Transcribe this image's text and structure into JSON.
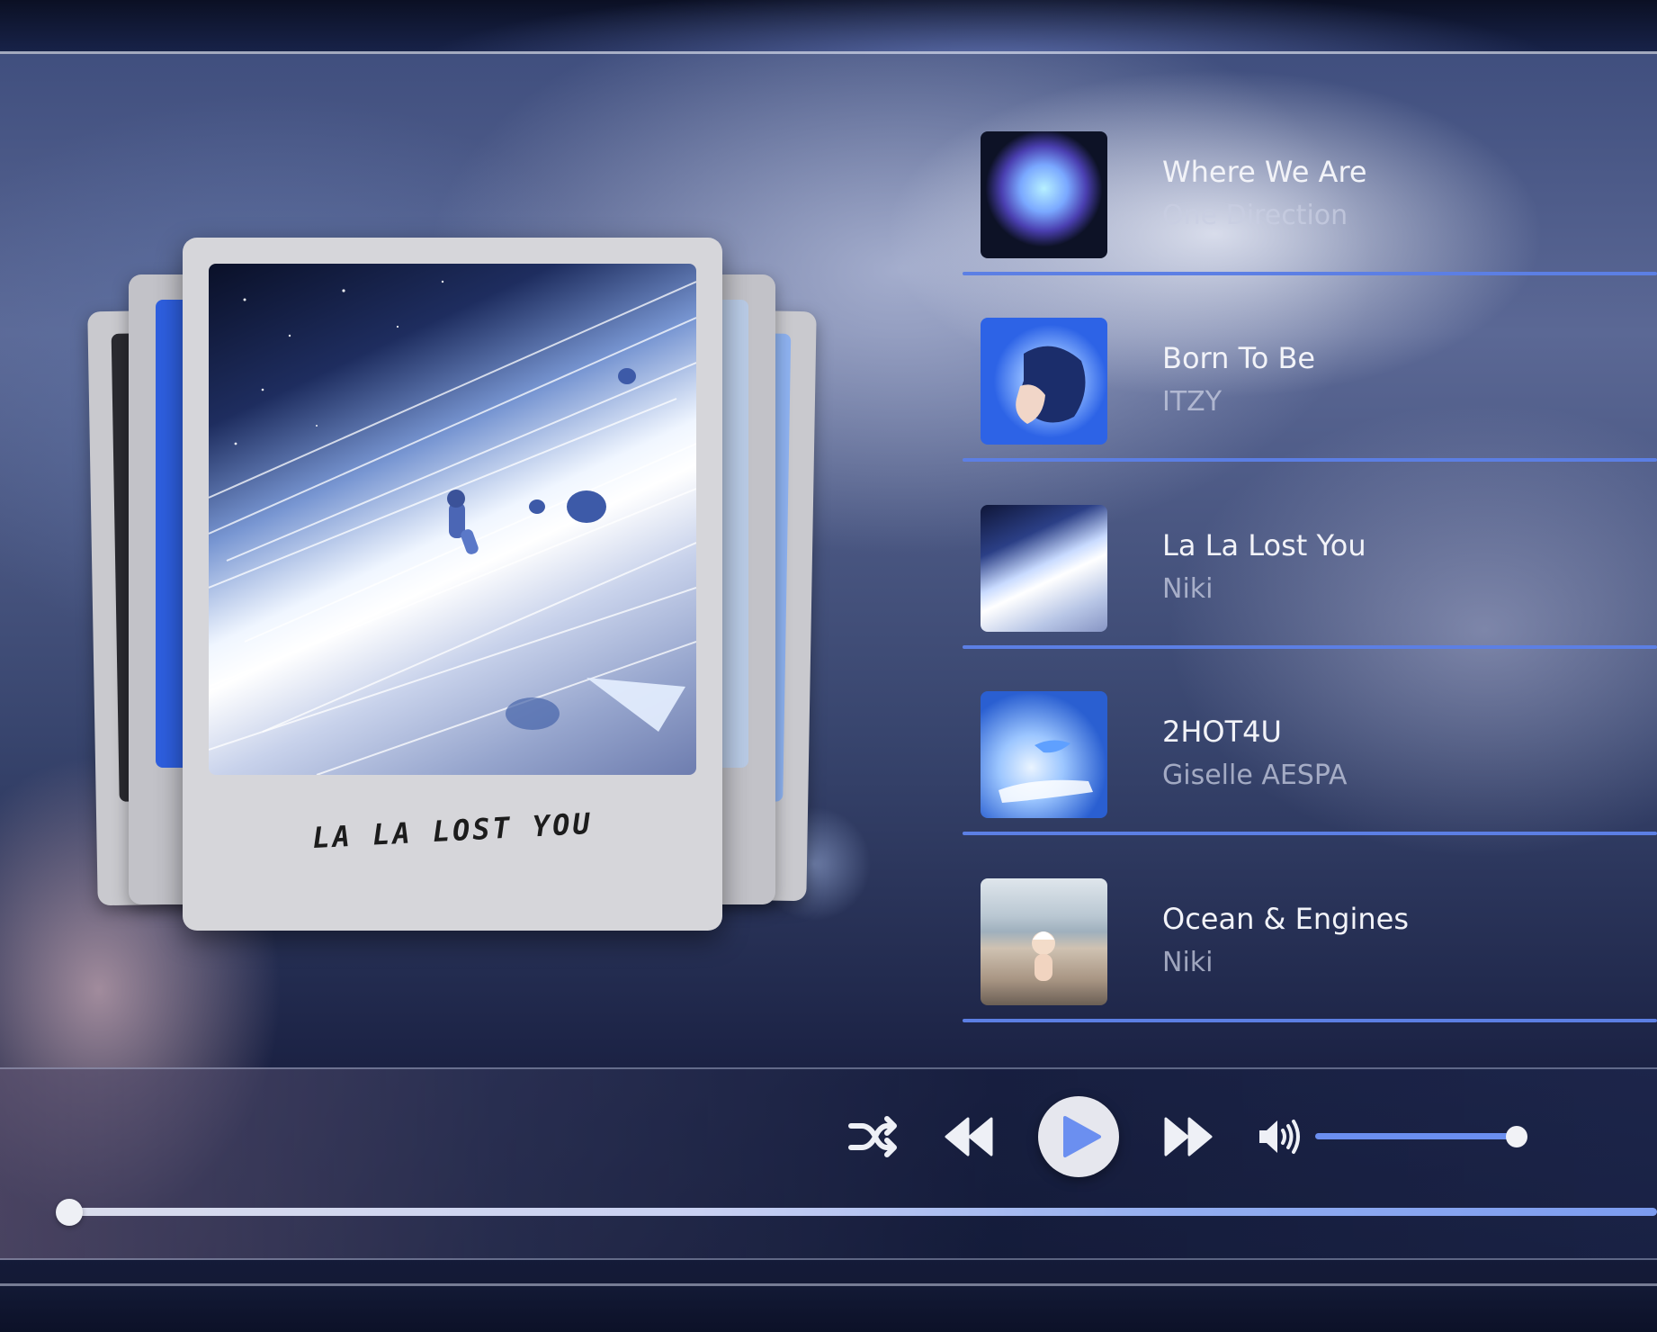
{
  "now_playing": {
    "polaroid_caption": "LA LA LOST YOU"
  },
  "playlist": [
    {
      "title": "Where We Are",
      "artist": "One Direction",
      "art_colors": [
        "#0d1226",
        "#7fb6ff"
      ]
    },
    {
      "title": "Born To Be",
      "artist": "ITZY",
      "art_colors": [
        "#2d63e6",
        "#9cc4ff"
      ]
    },
    {
      "title": "La La Lost You",
      "artist": "Niki",
      "art_colors": [
        "#1a2550",
        "#ffffff"
      ]
    },
    {
      "title": "2HOT4U",
      "artist": "Giselle AESPA",
      "art_colors": [
        "#2a5fd1",
        "#d9ecff"
      ]
    },
    {
      "title": "Ocean & Engines",
      "artist": "Niki",
      "art_colors": [
        "#c3cfd8",
        "#6b5f55"
      ]
    }
  ],
  "controls": {
    "shuffle_icon": "shuffle-icon",
    "previous_icon": "rewind-icon",
    "play_icon": "play-icon",
    "next_icon": "fast-forward-icon",
    "volume_icon": "speaker-icon",
    "volume_level": 1.0,
    "progress": 0.0
  },
  "colors": {
    "accent": "#5c7fe4",
    "play_button": "#e6e7ee",
    "play_triangle": "#6b8ff0"
  }
}
